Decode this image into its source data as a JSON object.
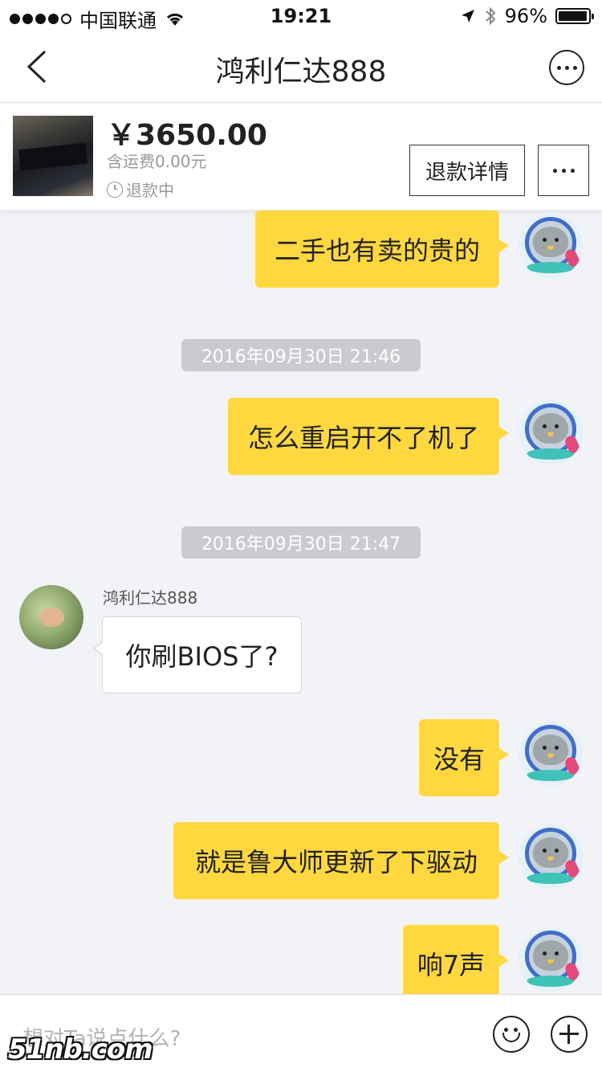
{
  "status_bar": {
    "carrier": "中国联通",
    "time": "19:21",
    "battery": "96%",
    "battery_level": 0.96,
    "icons": [
      "signal-dots-icon",
      "wifi-icon",
      "location-arrow-icon",
      "bluetooth-icon",
      "battery-icon"
    ]
  },
  "nav": {
    "title": "鸿利仁达888",
    "back_icon": "chevron-left-icon",
    "more_icon": "more-circle-icon"
  },
  "order": {
    "price": "￥3650.00",
    "shipping": "含运费0.00元",
    "status": "退款中",
    "refund_details_label": "退款详情",
    "more_icon": "ellipsis-icon"
  },
  "messages": [
    {
      "side": "mine",
      "text": "二手也有卖的贵的"
    },
    {
      "type": "timestamp",
      "text": "2016年09月30日  21:46"
    },
    {
      "side": "mine",
      "text": "怎么重启开不了机了"
    },
    {
      "type": "timestamp",
      "text": "2016年09月30日  21:47"
    },
    {
      "side": "theirs",
      "sender": "鸿利仁达888",
      "text": "你刷BIOS了?"
    },
    {
      "side": "mine",
      "text": "没有"
    },
    {
      "side": "mine",
      "text": "就是鲁大师更新了下驱动"
    },
    {
      "side": "mine",
      "text": "响7声"
    }
  ],
  "input": {
    "placeholder": "想对Ta说点什么?",
    "emoji_icon": "smiley-icon",
    "plus_icon": "plus-circle-icon"
  },
  "watermark": "51nb.com",
  "colors": {
    "my_bubble": "#ffd83f",
    "their_bubble": "#ffffff",
    "background": "#f2f3f7",
    "timestamp_bg": "#c9cbcf"
  }
}
